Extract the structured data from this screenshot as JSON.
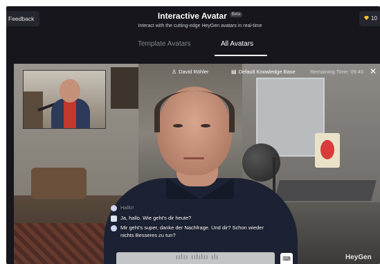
{
  "header": {
    "feedback_label": "Feedback",
    "title": "Interactive Avatar",
    "badge": "Beta",
    "subtitle": "Interact with the cutting-edge HeyGen avatars in real-time",
    "credits": "10",
    "credits_icon": "gem-icon"
  },
  "tabs": [
    {
      "label": "Template Avatars",
      "active": false
    },
    {
      "label": "All Avatars",
      "active": true
    }
  ],
  "session": {
    "user_name": "David Röhler",
    "user_icon": "person-icon",
    "knowledge_base": "Default Knowledge Base",
    "knowledge_icon": "document-icon",
    "remaining_time": "Remaining Time: 09:40",
    "close_icon": "close-icon"
  },
  "chat": [
    {
      "sender": "bot",
      "text": "Hallo!",
      "faded": true
    },
    {
      "sender": "user",
      "text": "Ja, hallo. Wie geht's dir heute?"
    },
    {
      "sender": "bot",
      "text": "Mir geht's super, danke der Nachfrage. Und dir? Schon wieder nichts Besseres zu tun?"
    }
  ],
  "input": {
    "waveform": "ıılıı ıılılıı ılı",
    "keyboard_icon": "keyboard-icon"
  },
  "watermark": "HeyGen"
}
